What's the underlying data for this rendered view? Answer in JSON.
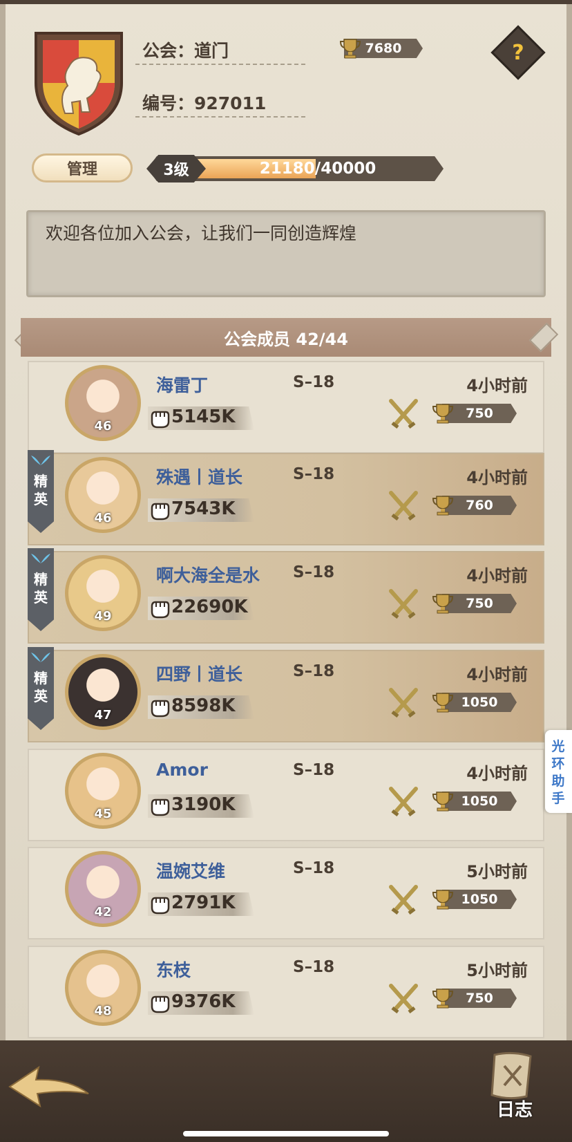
{
  "guild": {
    "name_label": "公会：道门",
    "id_label": "编号：927011",
    "trophies": "7680",
    "help": "?",
    "manage_label": "管理",
    "level": "3级",
    "exp_text": "21180/40000",
    "exp_progress": 0.5295,
    "notice": "欢迎各位加入公会，让我们一同创造辉煌"
  },
  "members_header": "公会成员 42/44",
  "elite_label": "精英",
  "members": [
    {
      "name": "海雷丁",
      "level": "46",
      "server": "S–18",
      "last_online": "4小时前",
      "power": "5145K",
      "trophies": "750",
      "elite": false
    },
    {
      "name": "殊遇丨道长",
      "level": "46",
      "server": "S–18",
      "last_online": "4小时前",
      "power": "7543K",
      "trophies": "760",
      "elite": true
    },
    {
      "name": "啊大海全是水",
      "level": "49",
      "server": "S–18",
      "last_online": "4小时前",
      "power": "22690K",
      "trophies": "750",
      "elite": true
    },
    {
      "name": "四野丨道长",
      "level": "47",
      "server": "S–18",
      "last_online": "4小时前",
      "power": "8598K",
      "trophies": "1050",
      "elite": true
    },
    {
      "name": "Amor",
      "level": "45",
      "server": "S–18",
      "last_online": "4小时前",
      "power": "3190K",
      "trophies": "1050",
      "elite": false
    },
    {
      "name": "温婉艾维",
      "level": "42",
      "server": "S–18",
      "last_online": "5小时前",
      "power": "2791K",
      "trophies": "1050",
      "elite": false
    },
    {
      "name": "东枝",
      "level": "48",
      "server": "S–18",
      "last_online": "5小时前",
      "power": "9376K",
      "trophies": "750",
      "elite": false
    }
  ],
  "side_tab": "光环助手",
  "footer": {
    "log_label": "日志"
  },
  "colors": {
    "name_blue": "#3e5f9a",
    "gold": "#c9a667",
    "panel": "#e5ddcd",
    "elite_bg": "#d5c3a4"
  }
}
